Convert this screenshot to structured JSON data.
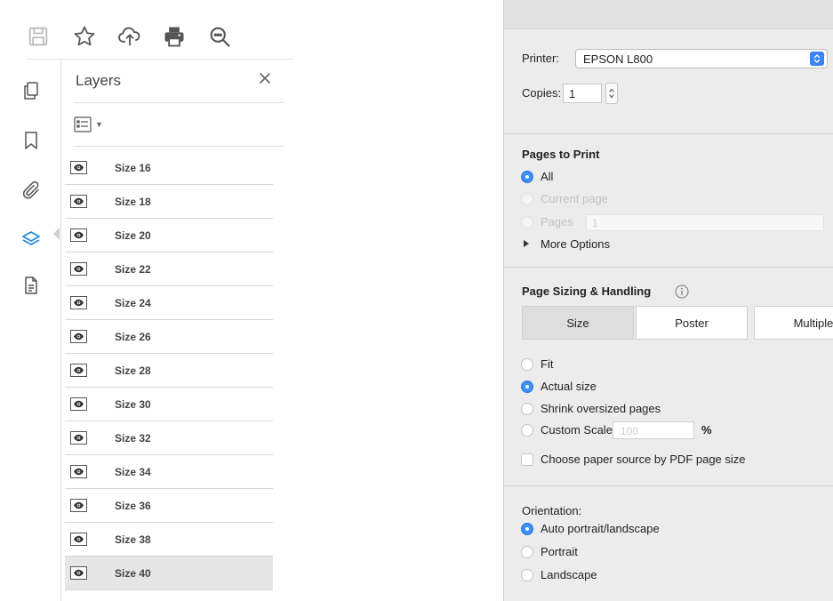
{
  "layers_panel": {
    "title": "Layers",
    "layers": [
      {
        "label": "Size 16",
        "selected": false
      },
      {
        "label": "Size 18",
        "selected": false
      },
      {
        "label": "Size 20",
        "selected": false
      },
      {
        "label": "Size 22",
        "selected": false
      },
      {
        "label": "Size 24",
        "selected": false
      },
      {
        "label": "Size 26",
        "selected": false
      },
      {
        "label": "Size 28",
        "selected": false
      },
      {
        "label": "Size 30",
        "selected": false
      },
      {
        "label": "Size 32",
        "selected": false
      },
      {
        "label": "Size 34",
        "selected": false
      },
      {
        "label": "Size 36",
        "selected": false
      },
      {
        "label": "Size 38",
        "selected": false
      },
      {
        "label": "Size 40",
        "selected": true
      }
    ]
  },
  "toolbar_icons": [
    "save-icon",
    "star-icon",
    "upload-icon",
    "print-icon",
    "search-icon"
  ],
  "rail_icons": [
    "pages-icon",
    "bookmark-icon",
    "attachment-icon",
    "layers-icon",
    "document-icon"
  ],
  "print_dialog": {
    "printer_label": "Printer:",
    "printer_value": "EPSON L800",
    "copies_label": "Copies:",
    "copies_value": "1",
    "pages_to_print": {
      "heading": "Pages to Print",
      "all": "All",
      "current_page": "Current page",
      "pages": "Pages",
      "pages_value": "1",
      "more_options": "More Options",
      "selected": "all"
    },
    "page_sizing": {
      "heading": "Page Sizing & Handling",
      "tabs": [
        "Size",
        "Poster",
        "Multiple"
      ],
      "selected_tab": "Size",
      "fit": "Fit",
      "actual_size": "Actual size",
      "shrink": "Shrink oversized pages",
      "custom_scale": "Custom Scale:",
      "scale_value": "100",
      "percent": "%",
      "choose_paper": "Choose paper source by PDF page size",
      "selected": "actual_size"
    },
    "orientation": {
      "heading": "Orientation:",
      "auto": "Auto portrait/landscape",
      "portrait": "Portrait",
      "landscape": "Landscape",
      "selected": "auto"
    }
  },
  "colors": {
    "accent_blue": "#3d8ff5",
    "dialog_bg": "#ececec",
    "selected_row": "#e6e6e6"
  }
}
